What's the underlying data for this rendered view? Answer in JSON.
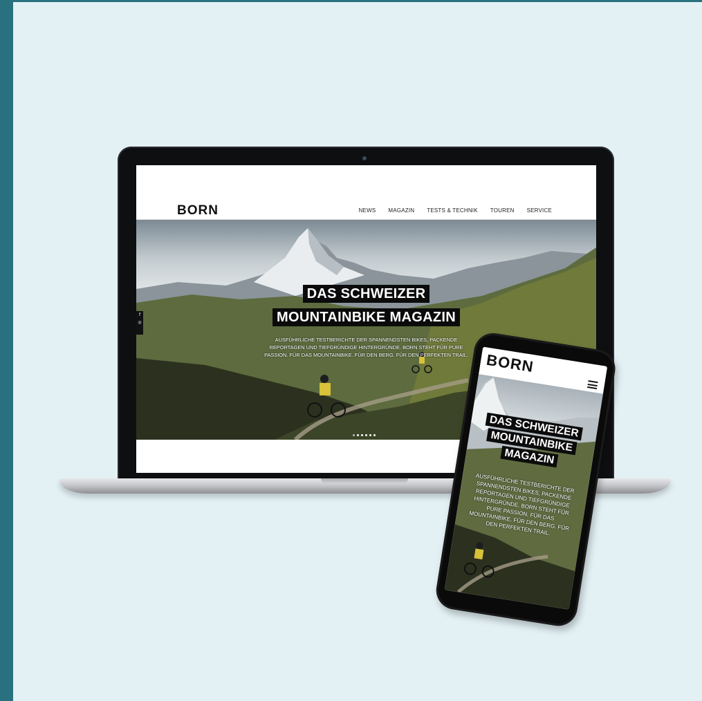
{
  "laptop": {
    "site": {
      "logo": "BORN",
      "nav": [
        "NEWS",
        "MAGAZIN",
        "TESTS & TECHNIK",
        "TOUREN",
        "SERVICE"
      ],
      "headline_line1": "DAS SCHWEIZER",
      "headline_line2": "MOUNTAINBIKE MAGAZIN",
      "intro": "AUSFÜHRLICHE TESTBERICHTE DER SPANNENDSTEN BIKES, PACKENDE REPORTAGEN UND TIEFGRÜNDIGE HINTERGRÜNDE. BORN STEHT FÜR PURE PASSION. FÜR DAS MOUNTAINBIKE. FÜR DEN BERG. FÜR DEN PERFEKTEN TRAIL.",
      "social": [
        "f",
        "◎"
      ],
      "slider_dots": 6
    }
  },
  "phone": {
    "site": {
      "logo": "BORN",
      "menu_icon": "hamburger-menu-icon",
      "headline_line1": "DAS SCHWEIZER",
      "headline_line2": "MOUNTAINBIKE",
      "headline_line3": "MAGAZIN",
      "intro": "AUSFÜHRLICHE TESTBERICHTE DER SPANNENDSTEN BIKES, PACKENDE REPORTAGEN UND TIEFGRÜNDIGE HINTERGRÜNDE. BORN STEHT FÜR PURE PASSION. FÜR DAS MOUNTAINBIKE. FÜR DEN BERG. FÜR DEN PERFEKTEN TRAIL."
    }
  },
  "colors": {
    "background": "#e3f1f5",
    "accent_bar": "#2a717f"
  }
}
